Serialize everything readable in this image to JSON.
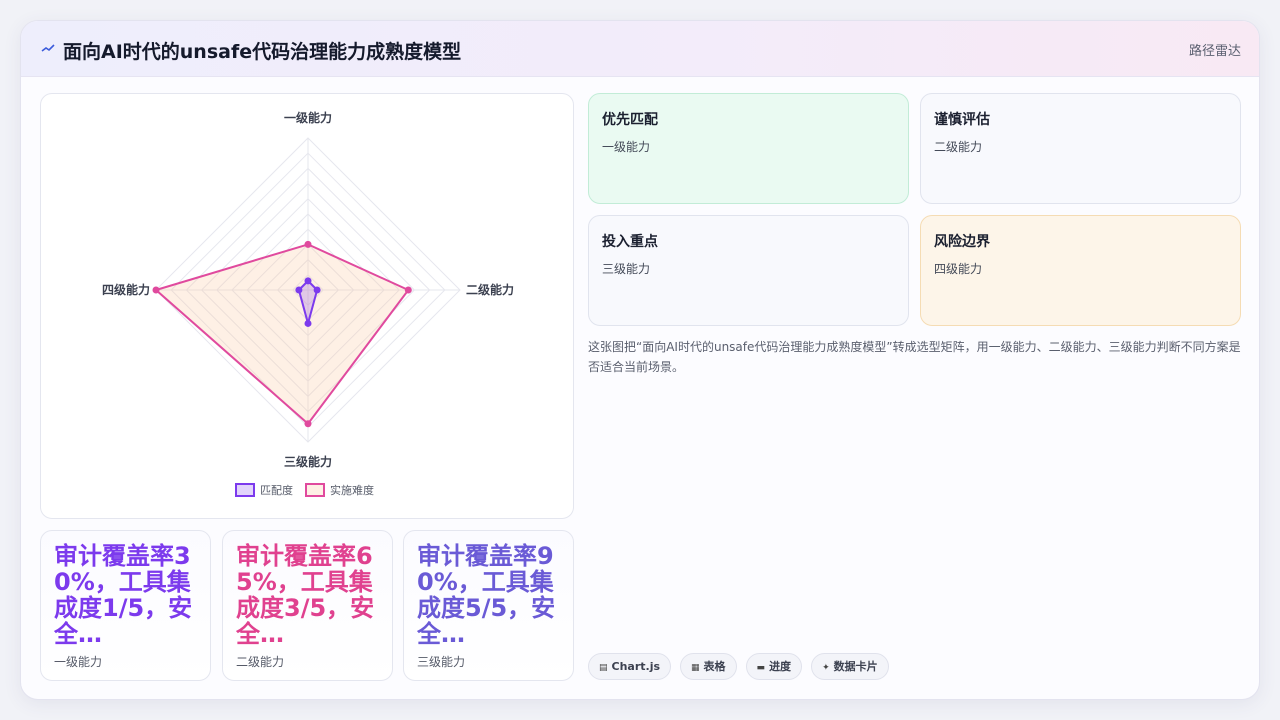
{
  "header": {
    "title": "面向AI时代的unsafe代码治理能力成熟度模型",
    "link": "路径雷达"
  },
  "chart_data": {
    "type": "radar",
    "categories": [
      "一级能力",
      "二级能力",
      "三级能力",
      "四级能力"
    ],
    "max": 5,
    "series": [
      {
        "name": "匹配度",
        "values": [
          0.3,
          0.3,
          1.1,
          0.3
        ],
        "color": "#7c3aed",
        "fill": "rgba(124,58,237,0.22)"
      },
      {
        "name": "实施难度",
        "values": [
          1.5,
          3.3,
          4.4,
          5.0
        ],
        "color": "#e04a9e",
        "fill": "rgba(251,200,160,0.28)"
      }
    ]
  },
  "metrics": [
    {
      "value": "审计覆盖率30%，工具集成度1/5，安全…",
      "label": "一级能力",
      "color": "#7c3aed"
    },
    {
      "value": "审计覆盖率65%，工具集成度3/5，安全…",
      "label": "二级能力",
      "color": "#e0418f"
    },
    {
      "value": "审计覆盖率90%，工具集成度5/5，安全…",
      "label": "三级能力",
      "color": "#6a5ad6"
    }
  ],
  "quadrants": [
    {
      "title": "优先匹配",
      "sub": "一级能力",
      "bg": "#eafaf2",
      "border": "#c2ecd7"
    },
    {
      "title": "谨慎评估",
      "sub": "二级能力",
      "bg": "#f8f9fd",
      "border": "#e1e4ee"
    },
    {
      "title": "投入重点",
      "sub": "三级能力",
      "bg": "#f8f9fd",
      "border": "#e1e4ee"
    },
    {
      "title": "风险边界",
      "sub": "四级能力",
      "bg": "#fdf5e9",
      "border": "#f5dcb4"
    }
  ],
  "description": "这张图把“面向AI时代的unsafe代码治理能力成熟度模型”转成选型矩阵，用一级能力、二级能力、三级能力判断不同方案是否适合当前场景。",
  "tags": [
    {
      "icon": "▤",
      "label": "Chart.js"
    },
    {
      "icon": "▦",
      "label": "表格"
    },
    {
      "icon": "▬",
      "label": "进度"
    },
    {
      "icon": "✦",
      "label": "数据卡片"
    }
  ]
}
